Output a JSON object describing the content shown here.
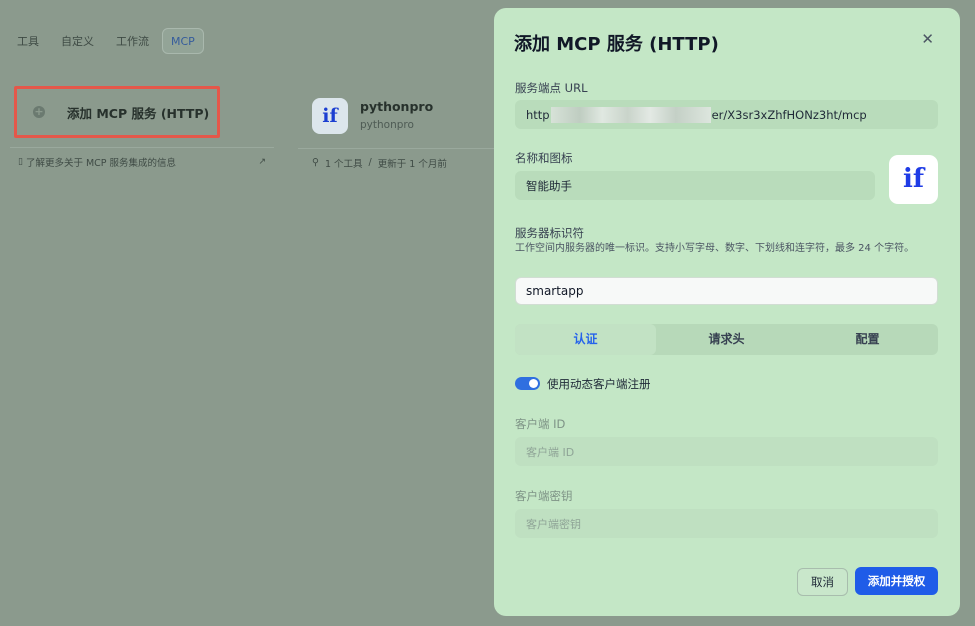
{
  "background": {
    "tabs": [
      {
        "label": "工具"
      },
      {
        "label": "自定义"
      },
      {
        "label": "工作流"
      },
      {
        "label": "MCP",
        "active": true
      }
    ],
    "add_card_label": "添加 MCP 服务 (HTTP)",
    "learn_more": "了解更多关于 MCP 服务集成的信息",
    "server": {
      "logo_text": "if",
      "name": "pythonpro",
      "subtitle": "pythonpro",
      "tools": "1 个工具",
      "separator": "/",
      "updated": "更新于 1 个月前"
    }
  },
  "modal": {
    "title": "添加 MCP 服务 (HTTP)",
    "url_label": "服务端点 URL",
    "url_prefix": "http",
    "url_suffix": "er/X3sr3xZhfHONz3ht/mcp",
    "name_label": "名称和图标",
    "name_value": "智能助手",
    "logo_text": "if",
    "identifier_label": "服务器标识符",
    "identifier_desc": "工作空间内服务器的唯一标识。支持小写字母、数字、下划线和连字符，最多 24 个字符。",
    "identifier_value": "smartapp",
    "tabs": [
      {
        "label": "认证",
        "active": true
      },
      {
        "label": "请求头"
      },
      {
        "label": "配置"
      }
    ],
    "dynamic_reg_label": "使用动态客户端注册",
    "dynamic_reg_on": true,
    "client_id_label": "客户端 ID",
    "client_id_placeholder": "客户端 ID",
    "client_secret_label": "客户端密钥",
    "client_secret_placeholder": "客户端密钥",
    "cancel_label": "取消",
    "submit_label": "添加并授权"
  },
  "colors": {
    "overlay": "#8b9a8d",
    "modal_bg": "#c4e7c6",
    "primary": "#1f5ce8",
    "highlight_border": "#e4574a",
    "logo_blue": "#1f3ce6"
  }
}
